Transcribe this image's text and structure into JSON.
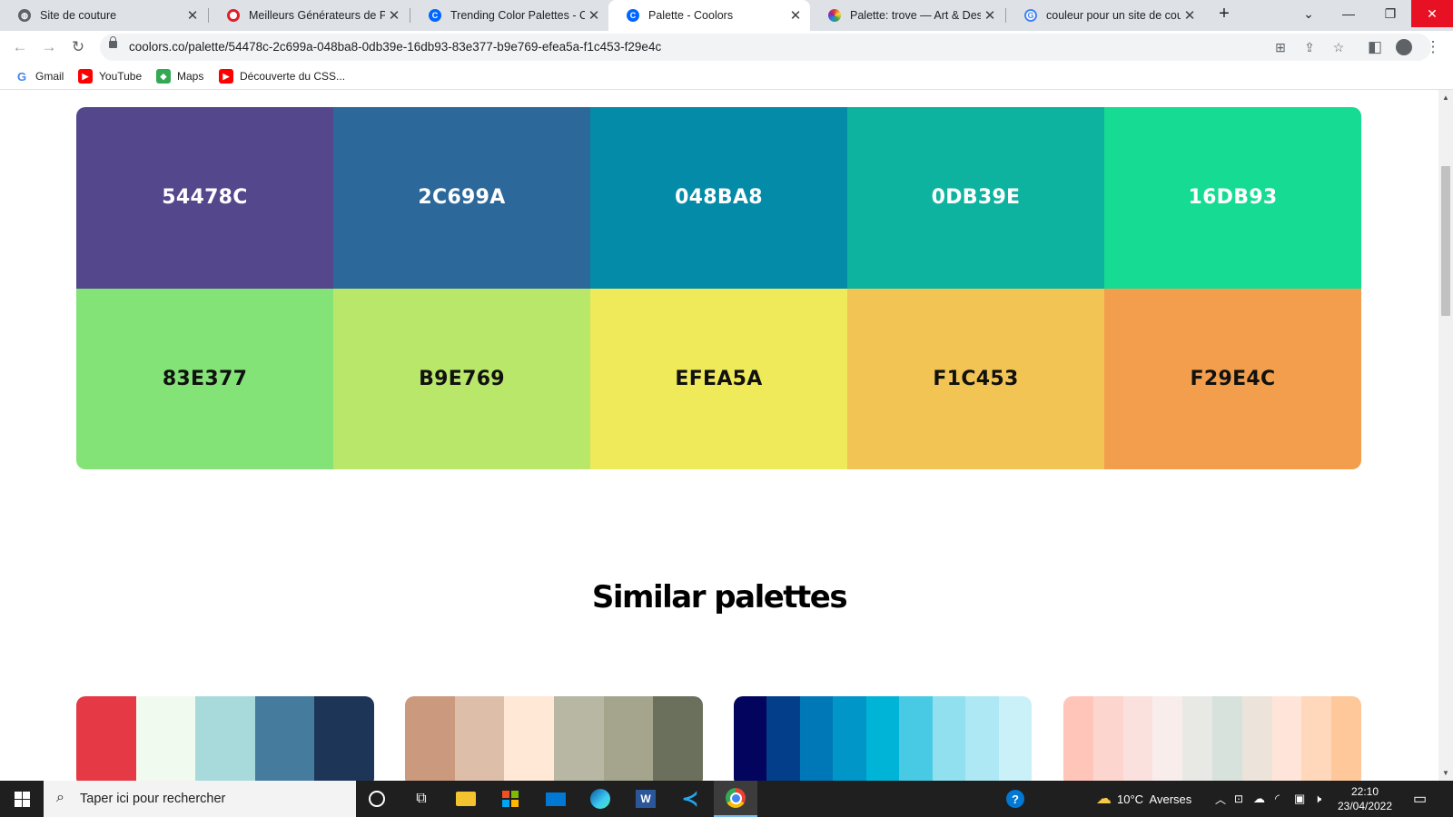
{
  "browser": {
    "tabs": [
      {
        "title": "Site de couture",
        "favicon": "globe-icon",
        "active": false
      },
      {
        "title": "Meilleurs Générateurs de Pale",
        "favicon": "opera-icon",
        "active": false
      },
      {
        "title": "Trending Color Palettes - Coo",
        "favicon": "coolors-icon",
        "active": false
      },
      {
        "title": "Palette - Coolors",
        "favicon": "coolors-icon",
        "active": true
      },
      {
        "title": "Palette: trove — Art & Design",
        "favicon": "color-wheel-icon",
        "active": false
      },
      {
        "title": "couleur pour un site de coutu",
        "favicon": "google-icon",
        "active": false
      }
    ],
    "new_tab_label": "+",
    "url": "coolors.co/palette/54478c-2c699a-048ba8-0db39e-16db93-83e377-b9e769-efea5a-f1c453-f29e4c",
    "bookmarks": [
      {
        "label": "Gmail",
        "icon": "google-icon"
      },
      {
        "label": "YouTube",
        "icon": "youtube-icon"
      },
      {
        "label": "Maps",
        "icon": "maps-icon"
      },
      {
        "label": "Découverte du CSS...",
        "icon": "youtube-icon"
      }
    ]
  },
  "palette": {
    "colors": [
      {
        "hex": "54478C",
        "bg": "#54478c",
        "fg": "#ffffff"
      },
      {
        "hex": "2C699A",
        "bg": "#2c699a",
        "fg": "#ffffff"
      },
      {
        "hex": "048BA8",
        "bg": "#048ba8",
        "fg": "#ffffff"
      },
      {
        "hex": "0DB39E",
        "bg": "#0db39e",
        "fg": "#ffffff"
      },
      {
        "hex": "16DB93",
        "bg": "#16db93",
        "fg": "#ffffff"
      },
      {
        "hex": "83E377",
        "bg": "#83e377",
        "fg": "#111111"
      },
      {
        "hex": "B9E769",
        "bg": "#b9e769",
        "fg": "#111111"
      },
      {
        "hex": "EFEA5A",
        "bg": "#efea5a",
        "fg": "#111111"
      },
      {
        "hex": "F1C453",
        "bg": "#f1c453",
        "fg": "#111111"
      },
      {
        "hex": "F29E4C",
        "bg": "#f29e4c",
        "fg": "#111111"
      }
    ]
  },
  "similar": {
    "title": "Similar palettes",
    "palettes": [
      [
        "#e63946",
        "#f1faee",
        "#a8dadc",
        "#457b9d",
        "#1d3557"
      ],
      [
        "#cb997e",
        "#ddbea9",
        "#ffe8d6",
        "#b7b7a4",
        "#a5a58d",
        "#6b705c"
      ],
      [
        "#03045e",
        "#023e8a",
        "#0077b6",
        "#0096c7",
        "#00b4d8",
        "#48cae4",
        "#90e0ef",
        "#ade8f4",
        "#caf0f8"
      ],
      [
        "#ffc5b9",
        "#fcd5ce",
        "#fae1dd",
        "#f8edeb",
        "#e8e8e4",
        "#d8e2dc",
        "#ece4db",
        "#ffe5d9",
        "#ffd7ba",
        "#fec89a"
      ]
    ]
  },
  "taskbar": {
    "search_placeholder": "Taper ici pour rechercher",
    "weather": "10°C  Averses",
    "time": "22:10",
    "date": "23/04/2022"
  }
}
